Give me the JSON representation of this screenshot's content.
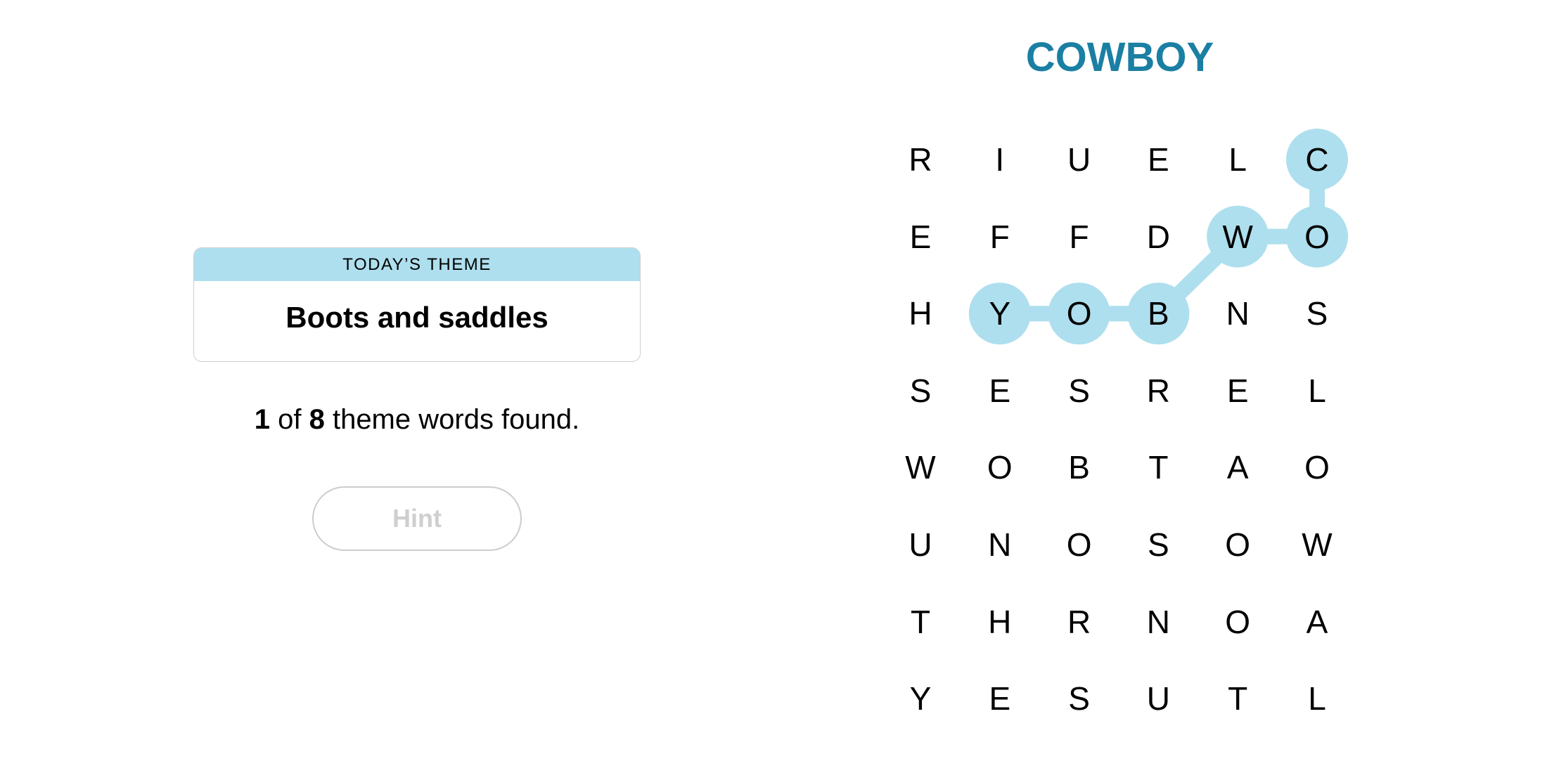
{
  "theme_card": {
    "header": "TODAY’S THEME",
    "theme": "Boots and saddles"
  },
  "progress": {
    "found": "1",
    "of_text": "of",
    "total": "8",
    "suffix": "theme words found."
  },
  "hint_button": {
    "label": "Hint",
    "enabled": false
  },
  "current_word": "COWBOY",
  "colors": {
    "highlight": "#aedfee",
    "title": "#1a7fa3"
  },
  "grid": {
    "rows": [
      [
        "R",
        "I",
        "U",
        "E",
        "L",
        "C"
      ],
      [
        "E",
        "F",
        "F",
        "D",
        "W",
        "O"
      ],
      [
        "H",
        "Y",
        "O",
        "B",
        "N",
        "S"
      ],
      [
        "S",
        "E",
        "S",
        "R",
        "E",
        "L"
      ],
      [
        "W",
        "O",
        "B",
        "T",
        "A",
        "O"
      ],
      [
        "U",
        "N",
        "O",
        "S",
        "O",
        "W"
      ],
      [
        "T",
        "H",
        "R",
        "N",
        "O",
        "A"
      ],
      [
        "Y",
        "E",
        "S",
        "U",
        "T",
        "L"
      ]
    ],
    "found_path": [
      [
        0,
        5
      ],
      [
        1,
        5
      ],
      [
        1,
        4
      ],
      [
        2,
        3
      ],
      [
        2,
        2
      ],
      [
        2,
        1
      ]
    ]
  }
}
